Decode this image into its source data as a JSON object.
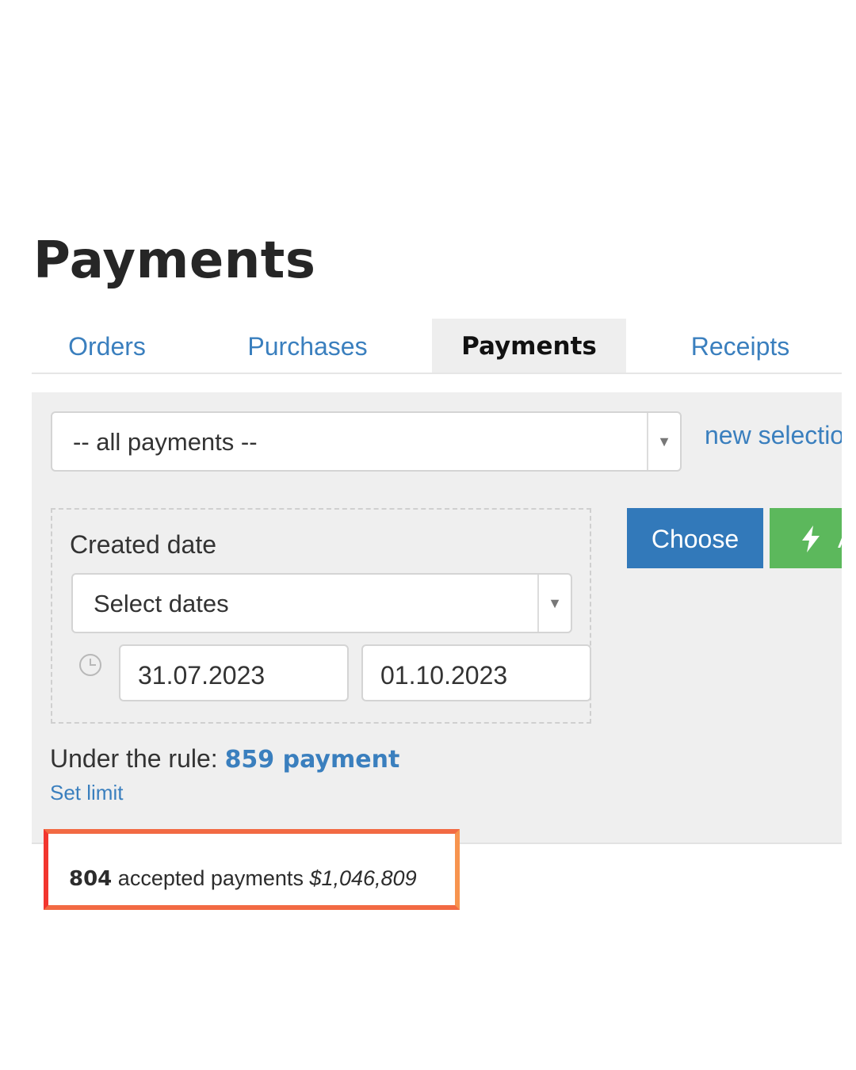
{
  "page": {
    "title": "Payments"
  },
  "tabs": [
    {
      "label": "Orders",
      "active": false
    },
    {
      "label": "Purchases",
      "active": false
    },
    {
      "label": "Payments",
      "active": true
    },
    {
      "label": "Receipts",
      "active": false
    }
  ],
  "filters": {
    "payment_type_select": {
      "selected": "-- all payments --",
      "arrow_icon": "triangle-down-icon"
    },
    "new_selection_link": "new selection",
    "created_date": {
      "label": "Created date",
      "range_select": "Select dates",
      "clock_icon": "clock-icon",
      "date_from": "31.07.2023",
      "date_to": "01.10.2023"
    }
  },
  "actions": {
    "choose_label": "Choose",
    "quick_button_icon": "lightning-bolt-icon",
    "quick_button_label": "A",
    "quick_button_color": "#5cb85c",
    "choose_color": "#3279ba"
  },
  "rule": {
    "prefix": "Under the rule: ",
    "count_text": "859 payment",
    "set_limit_label": "Set limit"
  },
  "summary": {
    "count": "804",
    "label": "accepted payments",
    "amount": "$1,046,809",
    "highlight_color": "#f26a43"
  }
}
